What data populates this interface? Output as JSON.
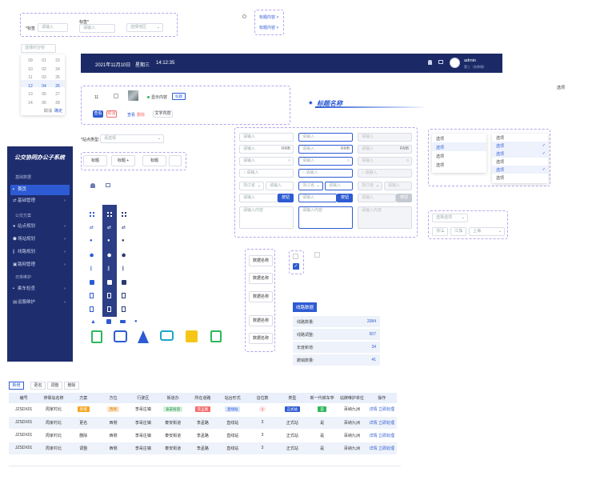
{
  "form_top": {
    "field1_label": "*标签",
    "field1_placeholder": "请输入",
    "field2_label": "标签*",
    "field2_placeholder": "请输入",
    "select_placeholder": "选择地区"
  },
  "link_buttons": [
    "标题内容 >",
    "标题内容 >"
  ],
  "time_picker": {
    "placeholder": "选择时分秒",
    "col1": [
      "09",
      "10",
      "11",
      "12",
      "13",
      "14"
    ],
    "col2": [
      "01",
      "02",
      "03",
      "04",
      "05",
      "06"
    ],
    "col3": [
      "23",
      "24",
      "25",
      "26",
      "27",
      "28"
    ],
    "cancel": "取消",
    "confirm": "确定"
  },
  "header_bar": {
    "date": "2021年11月10日",
    "weekday": "星期三",
    "time": "14:12:35",
    "user_name": "admin",
    "user_role": "第三（名称增）"
  },
  "select_label_right": "选项",
  "components_row": {
    "number": "11",
    "status_text": "显示内容",
    "tag_text": "标题",
    "btn1": "查看",
    "btn2": "取消",
    "link1": "查看",
    "link2": "删除",
    "text_btn": "文字内容"
  },
  "title_banner": "标题名称",
  "site_type": {
    "label": "*站点类型:",
    "placeholder": "请选择"
  },
  "tab_buttons": [
    "标题",
    "标题 +",
    "标题"
  ],
  "sidebar": {
    "title": "公交协同办公子系统",
    "groups": [
      {
        "label": "基础数据",
        "items": [
          {
            "label": "首页",
            "active": true
          },
          {
            "label": "基础管理",
            "active": false
          }
        ]
      },
      {
        "label": "公交方案",
        "items": [
          {
            "label": "站点规划",
            "active": false
          },
          {
            "label": "场站规划",
            "active": false
          },
          {
            "label": "线路规划",
            "active": false
          },
          {
            "label": "路网管理",
            "active": false
          }
        ]
      },
      {
        "label": "日常维护",
        "items": [
          {
            "label": "乘车检查",
            "active": false
          },
          {
            "label": "运服维护",
            "active": false
          }
        ]
      }
    ]
  },
  "input_grid": {
    "placeholder": "请输入",
    "unit": "RMB",
    "region1": "浙江省",
    "button": "按钮",
    "textarea_placeholder": "请输入内容"
  },
  "dropdown": {
    "left_options": [
      "选项",
      "选项",
      "选项",
      "选项"
    ],
    "right_options": [
      "选项",
      "选项",
      "选项",
      "选项",
      "选项",
      "选项"
    ],
    "select_placeholder": "选择选项",
    "cascade1": "浙江",
    "cascade2": "江苏",
    "cascade3": "上海"
  },
  "data_names": [
    "数据名称",
    "数据名称",
    "数据名称",
    "数据名称",
    "数据名称"
  ],
  "stats_card": {
    "title": "线路数据",
    "rows": [
      {
        "label": "线路数量:",
        "value": "2084"
      },
      {
        "label": "线路调整:",
        "value": "507"
      },
      {
        "label": "年度新增:",
        "value": "34"
      },
      {
        "label": "撤销数量:",
        "value": "41"
      }
    ]
  },
  "table": {
    "tabs": [
      "新增",
      "更名",
      "调整",
      "删除"
    ],
    "headers": [
      "编号",
      "停靠站名称",
      "方案",
      "方位",
      "行驶区",
      "街道办",
      "所在道路",
      "站台形式",
      "泊位数",
      "类型",
      "新一代候车亭",
      "站牌维护单位",
      "操作"
    ],
    "rows": [
      {
        "id": "JZSDX01",
        "name": "周家村北",
        "plan": "新增",
        "dir": "西侧",
        "area": "李哥庄镇",
        "street": "泰安街道",
        "road": "李孟路",
        "form": "直线站",
        "berth": "3",
        "type": "正式站",
        "pavilion": "是",
        "unit": "百纳九洲",
        "op1": "详情",
        "op2": "立即处理"
      },
      {
        "id": "JZSDX01",
        "name": "周家村北",
        "plan": "更名",
        "dir": "西侧",
        "area": "李哥庄镇",
        "street": "泰安街道",
        "road": "李孟路",
        "form": "直线站",
        "berth": "3",
        "type": "正式站",
        "pavilion": "是",
        "unit": "百纳九洲",
        "op1": "详情",
        "op2": "立即处理"
      },
      {
        "id": "JZSDX01",
        "name": "周家村北",
        "plan": "删除",
        "dir": "西侧",
        "area": "李哥庄镇",
        "street": "泰安街道",
        "road": "李孟路",
        "form": "直线站",
        "berth": "3",
        "type": "正式站",
        "pavilion": "是",
        "unit": "百纳九洲",
        "op1": "详情",
        "op2": "立即处理"
      },
      {
        "id": "JZSDX01",
        "name": "周家村北",
        "plan": "调整",
        "dir": "西侧",
        "area": "李哥庄镇",
        "street": "泰安街道",
        "road": "李孟路",
        "form": "直线站",
        "berth": "3",
        "type": "正式站",
        "pavilion": "是",
        "unit": "百纳九洲",
        "op1": "详情",
        "op2": "立即处理"
      }
    ]
  },
  "colors": {
    "primary": "#2d5bd3",
    "dark_nav": "#1b2a66",
    "sidebar": "#1e2d6e",
    "orange": "#f5a623",
    "red": "#f56c6c",
    "green": "#2eb85c"
  }
}
